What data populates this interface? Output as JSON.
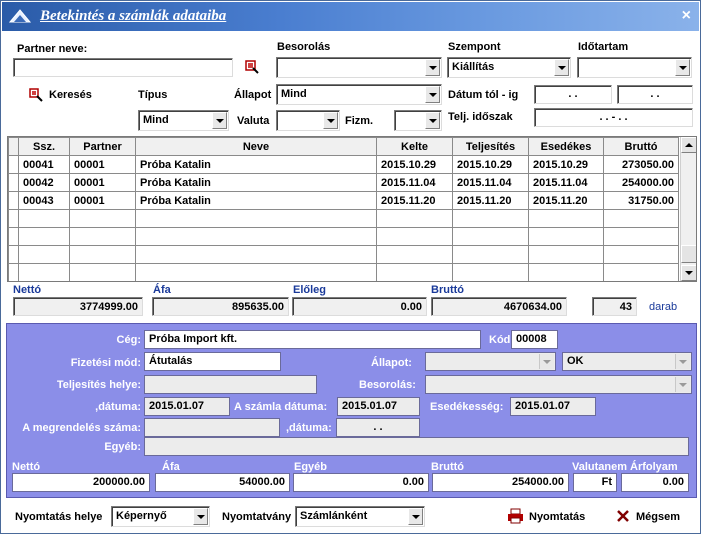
{
  "window": {
    "title": "Betekintés a számlák adataiba",
    "close": "×"
  },
  "filters": {
    "partner_label": "Partner neve:",
    "partner_value": "",
    "besorolas_label": "Besorolás",
    "besorolas_value": "",
    "szempont_label": "Szempont",
    "szempont_value": "Kiállítás",
    "idotartam_label": "Időtartam",
    "idotartam_value": "",
    "kereses_label": "Keresés",
    "tipus_label": "Típus",
    "tipus_value": "Mind",
    "allapot_label": "Állapot",
    "allapot_value": "Mind",
    "valuta_label": "Valuta",
    "valuta_value": "",
    "fizm_label": "Fizm.",
    "fizm_value": "",
    "datum_label": "Dátum tól - ig",
    "datum_from": ".   .",
    "datum_to": ".   .",
    "telj_label": "Telj. időszak",
    "telj_value": ".   .   -   .   ."
  },
  "table": {
    "headers": [
      "Ssz.",
      "Partner",
      "Neve",
      "Kelte",
      "Teljesítés",
      "Esedékes",
      "Bruttó"
    ],
    "rows": [
      [
        "00041",
        "00001",
        "Próba Katalin",
        "2015.10.29",
        "2015.10.29",
        "2015.10.29",
        "273050.00"
      ],
      [
        "00042",
        "00001",
        "Próba Katalin",
        "2015.11.04",
        "2015.11.04",
        "2015.11.04",
        "254000.00"
      ],
      [
        "00043",
        "00001",
        "Próba Katalin",
        "2015.11.20",
        "2015.11.20",
        "2015.11.20",
        "31750.00"
      ]
    ]
  },
  "totals": {
    "netto_label": "Nettó",
    "netto": "3774999.00",
    "afa_label": "Áfa",
    "afa": "895635.00",
    "eloleg_label": "Előleg",
    "eloleg": "0.00",
    "brutto_label": "Bruttó",
    "brutto": "4670634.00",
    "count": "43",
    "count_label": "darab"
  },
  "detail": {
    "ceg_label": "Cég:",
    "ceg": "Próba Import kft.",
    "kod_label": "Kód:",
    "kod": "00008",
    "fizmod_label": "Fizetési mód:",
    "fizmod": "Átutalás",
    "allapot_label": "Állapot:",
    "allapot1": "",
    "allapot2": "OK",
    "telj_hely_label": "Teljesítés helye:",
    "telj_hely": "",
    "besorolas_label": "Besorolás:",
    "besorolas": "",
    "datuma_label": ",dátuma:",
    "datuma": "2015.01.07",
    "szamla_datuma_label": "A számla dátuma:",
    "szamla_datuma": "2015.01.07",
    "esedekesseg_label": "Esedékesség:",
    "esedekesseg": "2015.01.07",
    "megrendeles_label": "A megrendelés száma:",
    "megrendeles": "",
    "datuma2_label": ",dátuma:",
    "datuma2": ".   .",
    "egyeb_label": "Egyéb:",
    "egyeb": "",
    "netto_label": "Nettó",
    "netto": "200000.00",
    "afa_label": "Áfa",
    "afa": "54000.00",
    "egyeb2_label": "Egyéb",
    "egyeb2": "0.00",
    "brutto_label": "Bruttó",
    "brutto": "254000.00",
    "valutanem_label": "Valutanem",
    "valutanem": "Ft",
    "arfolyam_label": "Árfolyam",
    "arfolyam": "0.00"
  },
  "footer": {
    "nyomtatas_helye_label": "Nyomtatás helye",
    "nyomtatas_helye": "Képernyő",
    "nyomtatvany_label": "Nyomtatvány",
    "nyomtatvany": "Számlánként",
    "nyomtatas_button": "Nyomtatás",
    "megsem_button": "Mégsem"
  }
}
